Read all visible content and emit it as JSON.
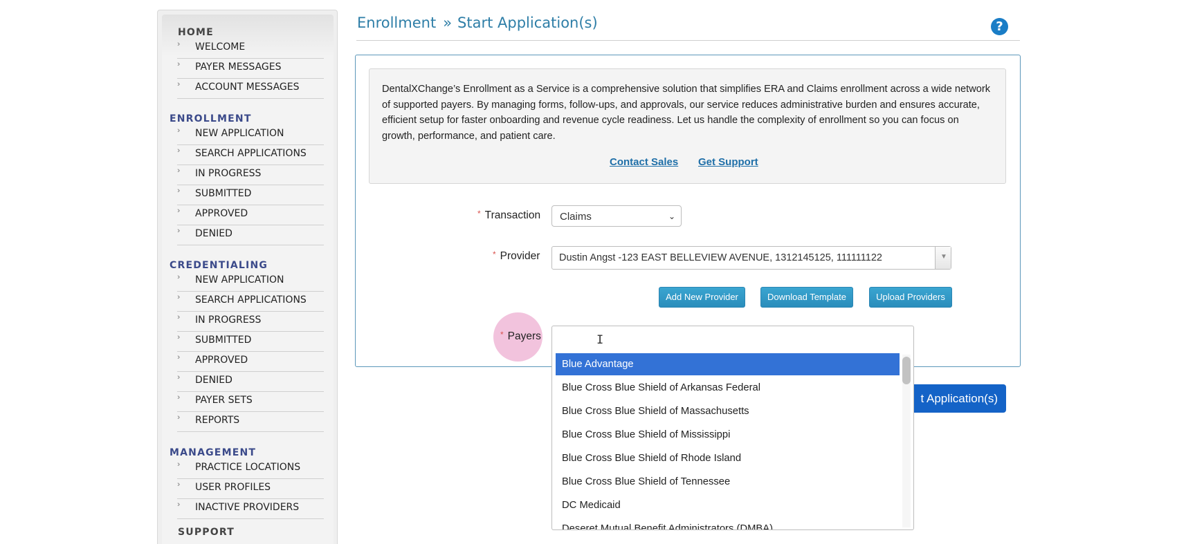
{
  "header": {
    "breadcrumb_root": "Enrollment",
    "breadcrumb_separator": "»",
    "page_title": "Start Application(s)",
    "help_icon_glyph": "?"
  },
  "sidebar": {
    "home": {
      "heading": "HOME",
      "items": [
        "WELCOME",
        "PAYER MESSAGES",
        "ACCOUNT MESSAGES"
      ]
    },
    "enrollment": {
      "heading": "ENROLLMENT",
      "items": [
        "NEW APPLICATION",
        "SEARCH APPLICATIONS",
        "IN PROGRESS",
        "SUBMITTED",
        "APPROVED",
        "DENIED"
      ]
    },
    "credentialing": {
      "heading": "CREDENTIALING",
      "items": [
        "NEW APPLICATION",
        "SEARCH APPLICATIONS",
        "IN PROGRESS",
        "SUBMITTED",
        "APPROVED",
        "DENIED",
        "PAYER SETS",
        "REPORTS"
      ]
    },
    "management": {
      "heading": "MANAGEMENT",
      "items": [
        "PRACTICE LOCATIONS",
        "USER PROFILES",
        "INACTIVE PROVIDERS"
      ]
    },
    "support": {
      "heading": "SUPPORT"
    },
    "arrow_glyph": "››"
  },
  "info": {
    "text": "DentalXChange’s Enrollment as a Service is a comprehensive solution that simplifies ERA and Claims enrollment across a wide network of supported payers. By managing forms, follow-ups, and approvals, our service reduces administrative burden and ensures accurate, efficient setup for faster onboarding and revenue cycle readiness. Let us handle the complexity of enrollment so you can focus on growth, performance, and patient care.",
    "contact_sales": "Contact Sales",
    "get_support": "Get Support"
  },
  "form": {
    "required_marker": "*",
    "transaction_label": "Transaction",
    "transaction_value": "Claims",
    "provider_label": "Provider",
    "provider_value": "Dustin Angst -123 EAST BELLEVIEW AVENUE, 1312145125, 111111122",
    "add_provider_button": "Add New Provider",
    "download_template_button": "Download Template",
    "upload_providers_button": "Upload Providers",
    "payers_label": "Payers",
    "payers_input_value": "",
    "start_button": "t Application(s)"
  },
  "payers_dropdown": {
    "selected_index": 0,
    "options": [
      "Blue Advantage",
      "Blue Cross Blue Shield of Arkansas Federal",
      "Blue Cross Blue Shield of Massachusetts",
      "Blue Cross Blue Shield of Mississippi",
      "Blue Cross Blue Shield of Rhode Island",
      "Blue Cross Blue Shield of Tennessee",
      "DC Medicaid",
      "Deseret Mutual Benefit Administrators (DMBA)"
    ]
  },
  "colors": {
    "title_blue": "#2e7ea7",
    "sidebar_heading": "#3b4a8a",
    "selected_option": "#3372d6",
    "start_button": "#1463c7",
    "small_button": "#2a8dbb",
    "highlight_pink": "#f0b8d7"
  }
}
